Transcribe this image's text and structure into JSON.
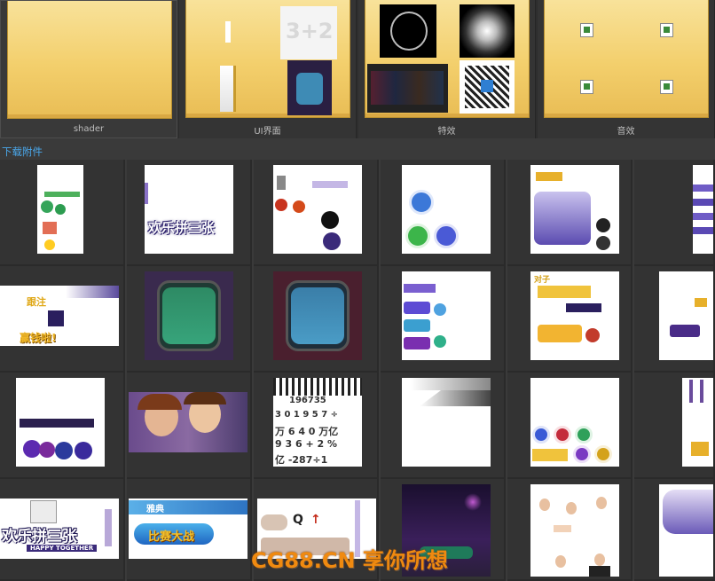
{
  "folders": [
    {
      "label": "shader"
    },
    {
      "label": "UI界面"
    },
    {
      "label": "特效"
    },
    {
      "label": "音效"
    }
  ],
  "section": {
    "title": "下载附件"
  },
  "thumbnails": {
    "logo_text": "欢乐拼三张",
    "logo_subtext": "HAPPY TOGETHER",
    "digits_rows": [
      "196735",
      "3 0 1 9 5 7 ÷",
      "万 6 4 0 万亿",
      "9 3 6 + 2 %",
      "亿  -287÷1"
    ],
    "ui_texts": {
      "pair": "对子",
      "follow": "跟注",
      "joker": "雅典",
      "contest": "比赛大战",
      "win": "赢钱啦!",
      "three_two": "3+2"
    }
  },
  "colors": {
    "folder": "#f3cf6c",
    "link": "#4aa7ea",
    "watermark": "#f08a10",
    "background": "#3a3a3a"
  },
  "watermark": {
    "text": "CG88.CN 享你所想"
  }
}
